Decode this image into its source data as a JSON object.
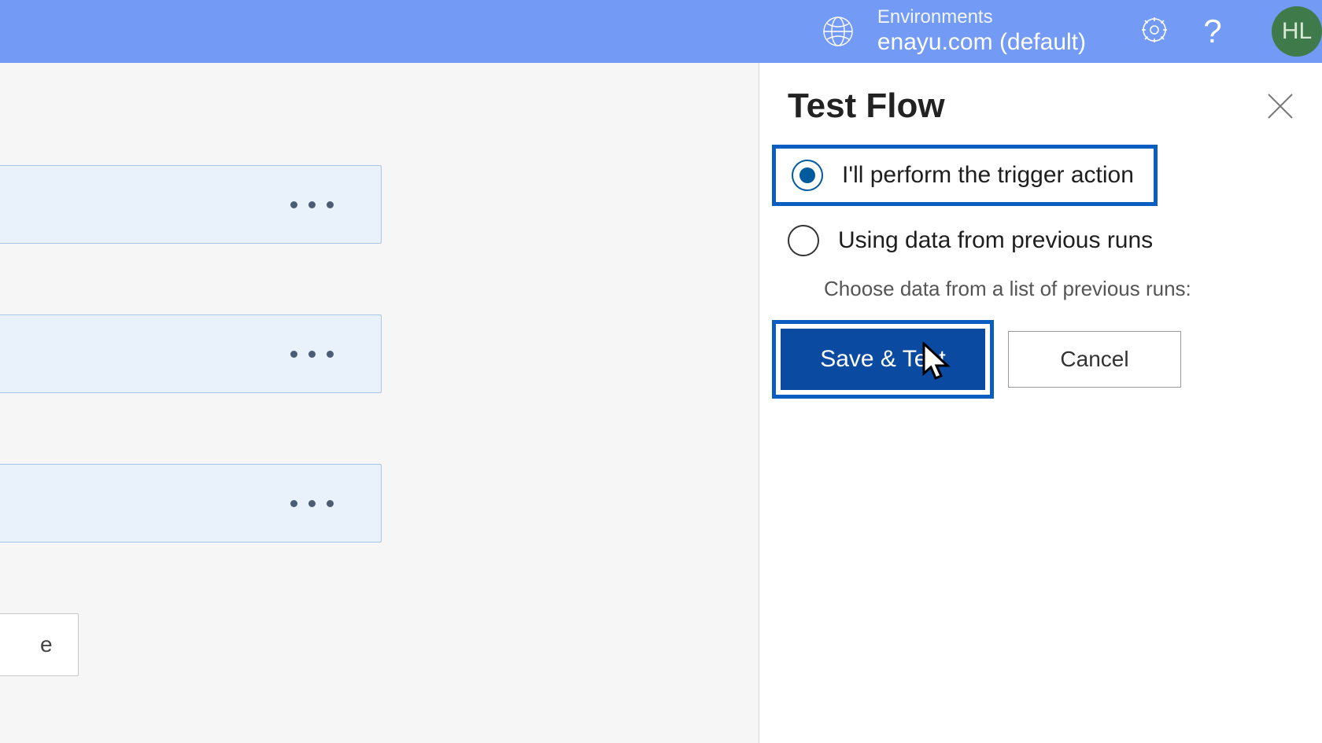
{
  "header": {
    "env_label": "Environments",
    "env_name": "enayu.com (default)",
    "avatar_initials": "HL"
  },
  "panel": {
    "title": "Test Flow",
    "options": [
      {
        "label": "I'll perform the trigger action",
        "selected": true
      },
      {
        "label": "Using data from previous runs",
        "selected": false,
        "sub": "Choose data from a list of previous runs:"
      }
    ],
    "save_label": "Save & Test",
    "cancel_label": "Cancel"
  },
  "canvas": {
    "connector_tail": "e"
  }
}
